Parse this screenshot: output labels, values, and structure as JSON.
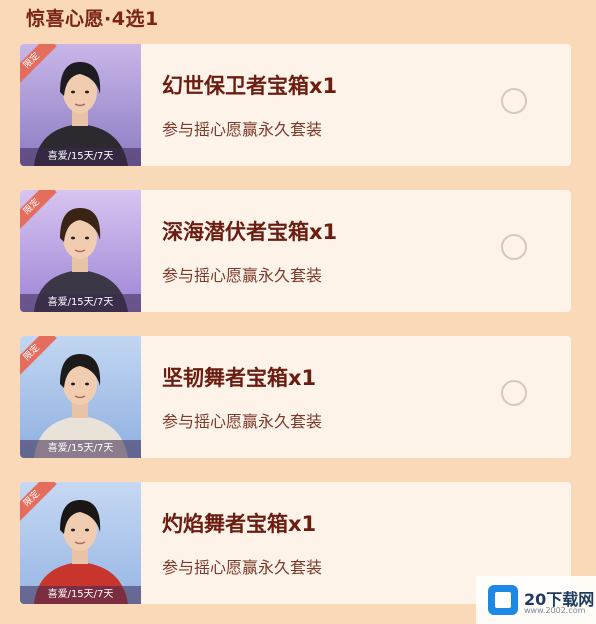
{
  "title": "惊喜心愿·4选1",
  "cards": [
    {
      "name": "幻世保卫者宝箱x1",
      "desc": "参与摇心愿赢永久套装",
      "tag": "限定",
      "duration": "喜爱/15天/7天",
      "bg_top": "#c9b6e8",
      "bg_bottom": "#8c7cc4",
      "hair": "#1c1c22",
      "outfit": "#2c2a2e"
    },
    {
      "name": "深海潜伏者宝箱x1",
      "desc": "参与摇心愿赢永久套装",
      "tag": "限定",
      "duration": "喜爱/15天/7天",
      "bg_top": "#d7c4f0",
      "bg_bottom": "#9e86d6",
      "hair": "#3a2416",
      "outfit": "#3b3746"
    },
    {
      "name": "坚韧舞者宝箱x1",
      "desc": "参与摇心愿赢永久套装",
      "tag": "限定",
      "duration": "喜爱/15天/7天",
      "bg_top": "#c2d6f2",
      "bg_bottom": "#8fb0e0",
      "hair": "#1d1a1a",
      "outfit": "#e8e2d8"
    },
    {
      "name": "灼焰舞者宝箱x1",
      "desc": "参与摇心愿赢永久套装",
      "tag": "限定",
      "duration": "喜爱/15天/7天",
      "bg_top": "#c6d8f3",
      "bg_bottom": "#96b6e4",
      "hair": "#1a1616",
      "outfit": "#c8352c"
    }
  ],
  "watermark": {
    "brand": "20下载网",
    "url": "www.2002.com"
  }
}
